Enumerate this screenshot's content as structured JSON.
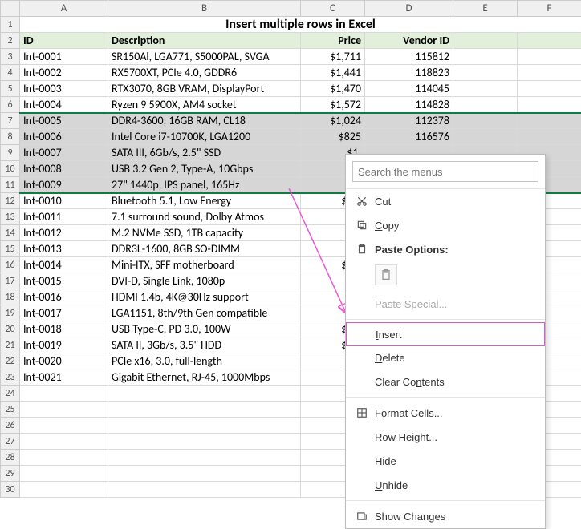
{
  "columns": [
    "A",
    "B",
    "C",
    "D",
    "E",
    "F"
  ],
  "title": "Insert multiple rows in Excel",
  "headers": {
    "a": "ID",
    "b": "Description",
    "c": "Price",
    "d": "Vendor ID"
  },
  "rows": [
    {
      "n": 3,
      "id": "Int-0001",
      "desc": "SR150Al, LGA771, S5000PAL, SVGA",
      "price": "$1,711",
      "vendor": "115812"
    },
    {
      "n": 4,
      "id": "Int-0002",
      "desc": "RX5700XT, PCIe 4.0, GDDR6",
      "price": "$1,441",
      "vendor": "118823"
    },
    {
      "n": 5,
      "id": "Int-0003",
      "desc": "RTX3070, 8GB VRAM, DisplayPort",
      "price": "$1,470",
      "vendor": "114045"
    },
    {
      "n": 6,
      "id": "Int-0004",
      "desc": "Ryzen 9 5900X, AM4 socket",
      "price": "$1,572",
      "vendor": "114828"
    },
    {
      "n": 7,
      "id": "Int-0005",
      "desc": "DDR4-3600, 16GB RAM, CL18",
      "price": "$1,024",
      "vendor": "112378",
      "sel": true,
      "first": true
    },
    {
      "n": 8,
      "id": "Int-0006",
      "desc": "Intel Core i7-10700K, LGA1200",
      "price": "$825",
      "vendor": "116576",
      "sel": true
    },
    {
      "n": 9,
      "id": "Int-0007",
      "desc": "SATA III, 6Gb/s, 2.5\" SSD",
      "price": "$1,",
      "vendor": "",
      "sel": true
    },
    {
      "n": 10,
      "id": "Int-0008",
      "desc": "USB 3.2 Gen 2, Type-A, 10Gbps",
      "price": "$1,",
      "vendor": "",
      "sel": true
    },
    {
      "n": 11,
      "id": "Int-0009",
      "desc": "27\" 1440p, IPS panel, 165Hz",
      "price": "$1,",
      "vendor": "",
      "sel": true,
      "last": true
    },
    {
      "n": 12,
      "id": "Int-0010",
      "desc": "Bluetooth 5.1, Low Energy",
      "price": "$1,4",
      "vendor": ""
    },
    {
      "n": 13,
      "id": "Int-0011",
      "desc": "7.1 surround sound, Dolby Atmos",
      "price": "$1,",
      "vendor": ""
    },
    {
      "n": 14,
      "id": "Int-0012",
      "desc": "M.2 NVMe SSD, 1TB capacity",
      "price": "$1,",
      "vendor": ""
    },
    {
      "n": 15,
      "id": "Int-0013",
      "desc": "DDR3L-1600, 8GB SO-DIMM",
      "price": "$1,",
      "vendor": ""
    },
    {
      "n": 16,
      "id": "Int-0014",
      "desc": "Mini-ITX, SFF motherboard",
      "price": "$1,8",
      "vendor": ""
    },
    {
      "n": 17,
      "id": "Int-0015",
      "desc": "DVI-D, Single Link, 1080p",
      "price": "$1,",
      "vendor": ""
    },
    {
      "n": 18,
      "id": "Int-0016",
      "desc": "HDMI 1.4b, 4K@30Hz support",
      "price": "$1,",
      "vendor": ""
    },
    {
      "n": 19,
      "id": "Int-0017",
      "desc": "LGA1151, 8th/9th Gen compatible",
      "price": "$",
      "vendor": ""
    },
    {
      "n": 20,
      "id": "Int-0018",
      "desc": "USB Type-C, PD 3.0, 100W",
      "price": "$1,4",
      "vendor": ""
    },
    {
      "n": 21,
      "id": "Int-0019",
      "desc": "SATA II, 3Gb/s, 3.5\" HDD",
      "price": "$1,0",
      "vendor": ""
    },
    {
      "n": 22,
      "id": "Int-0020",
      "desc": "PCIe x16, 3.0, full-length",
      "price": "$1,",
      "vendor": ""
    },
    {
      "n": 23,
      "id": "Int-0021",
      "desc": "Gigabit Ethernet, RJ-45, 1000Mbps",
      "price": "$1,",
      "vendor": ""
    }
  ],
  "empty_rows": [
    24,
    25,
    26,
    27,
    28,
    29,
    30
  ],
  "menu": {
    "search_placeholder": "Search the menus",
    "cut": "Cut",
    "copy": "Copy",
    "paste_options": "Paste Options:",
    "paste_special": "Paste Special...",
    "insert": "Insert",
    "delete": "Delete",
    "clear": "Clear Contents",
    "format_cells": "Format Cells...",
    "row_height": "Row Height...",
    "hide": "Hide",
    "unhide": "Unhide",
    "show_changes": "Show Changes"
  }
}
